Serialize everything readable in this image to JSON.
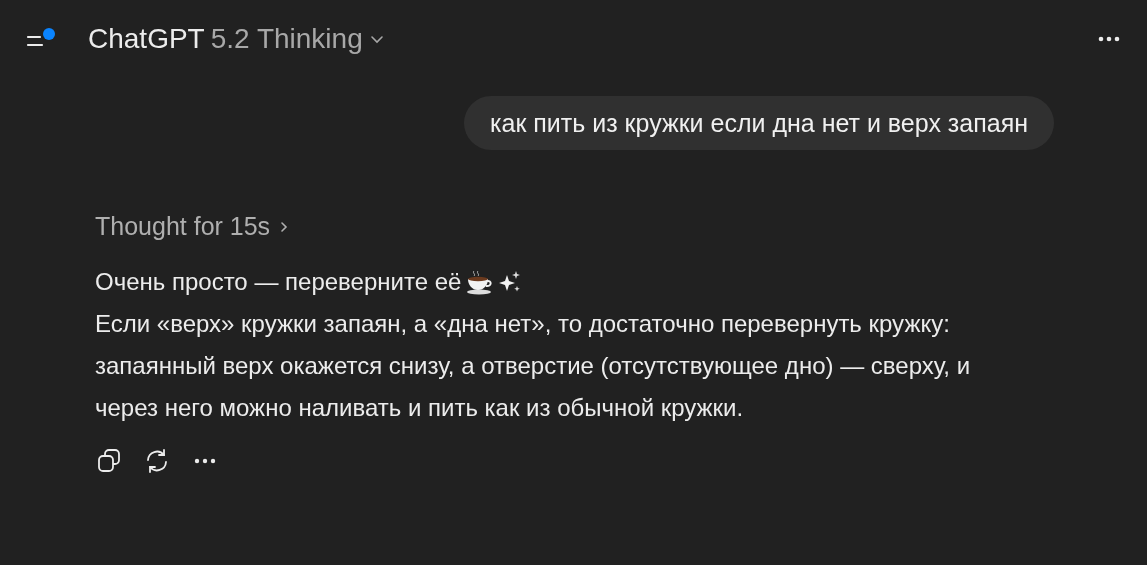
{
  "header": {
    "brand": "ChatGPT",
    "model": "5.2 Thinking"
  },
  "user_message": "как пить из кружки если дна нет и верх запаян",
  "thought": {
    "label": "Thought for 15s",
    "expanded": false
  },
  "answer": {
    "first_line": "Очень просто — переверните её",
    "paragraph": "Если «верх» кружки запаян, а «дна нет», то достаточно перевернуть кружку: запаянный верх окажется снизу, а отверстие (отсутствующее дно) — сверху, и через него можно наливать и пить как из обычной кружки."
  }
}
